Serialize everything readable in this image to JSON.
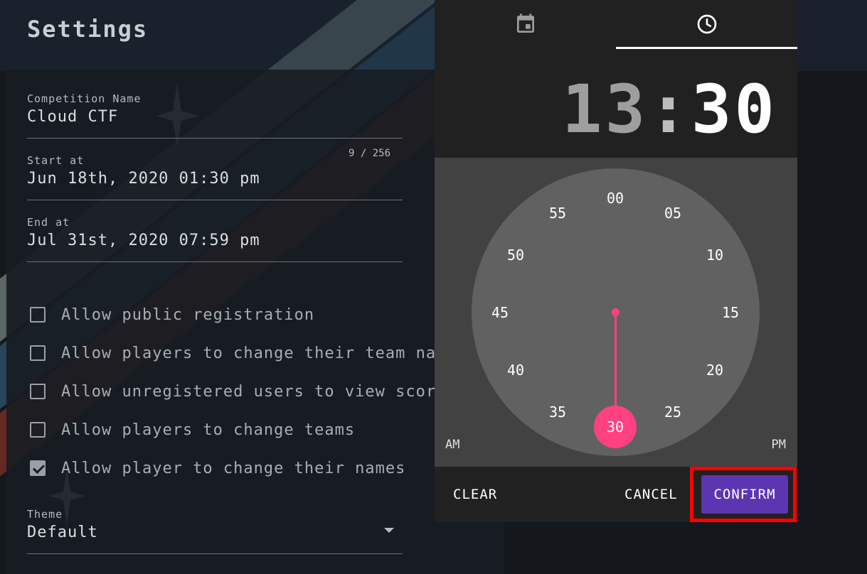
{
  "page": {
    "title": "Settings"
  },
  "form": {
    "competition_name": {
      "label": "Competition Name",
      "value": "Cloud CTF",
      "counter": "9 / 256"
    },
    "start_at": {
      "label": "Start at",
      "value": "Jun 18th, 2020 01:30 pm"
    },
    "end_at": {
      "label": "End at",
      "value": "Jul 31st, 2020 07:59 pm"
    },
    "checkboxes": [
      {
        "label": "Allow public registration",
        "checked": false
      },
      {
        "label": "Allow players to change their team name",
        "checked": false
      },
      {
        "label": "Allow unregistered users to view scoreboard",
        "checked": false
      },
      {
        "label": "Allow players to change teams",
        "checked": false
      },
      {
        "label": "Allow player to change their names",
        "checked": true
      }
    ],
    "theme": {
      "label": "Theme",
      "value": "Default"
    }
  },
  "picker": {
    "tabs": [
      {
        "icon": "calendar-icon"
      },
      {
        "icon": "clock-icon",
        "active": true
      }
    ],
    "time": {
      "hour": "13",
      "separator": ":",
      "minute": "30"
    },
    "clock_numbers": [
      "00",
      "05",
      "10",
      "15",
      "20",
      "25",
      "30",
      "35",
      "40",
      "45",
      "50",
      "55"
    ],
    "selected_minute": "30",
    "am_label": "AM",
    "pm_label": "PM",
    "actions": {
      "clear": "CLEAR",
      "cancel": "CANCEL",
      "confirm": "CONFIRM"
    }
  },
  "colors": {
    "accent": "#ff4081",
    "confirm": "#5e35b1",
    "highlight": "#ff0000"
  }
}
